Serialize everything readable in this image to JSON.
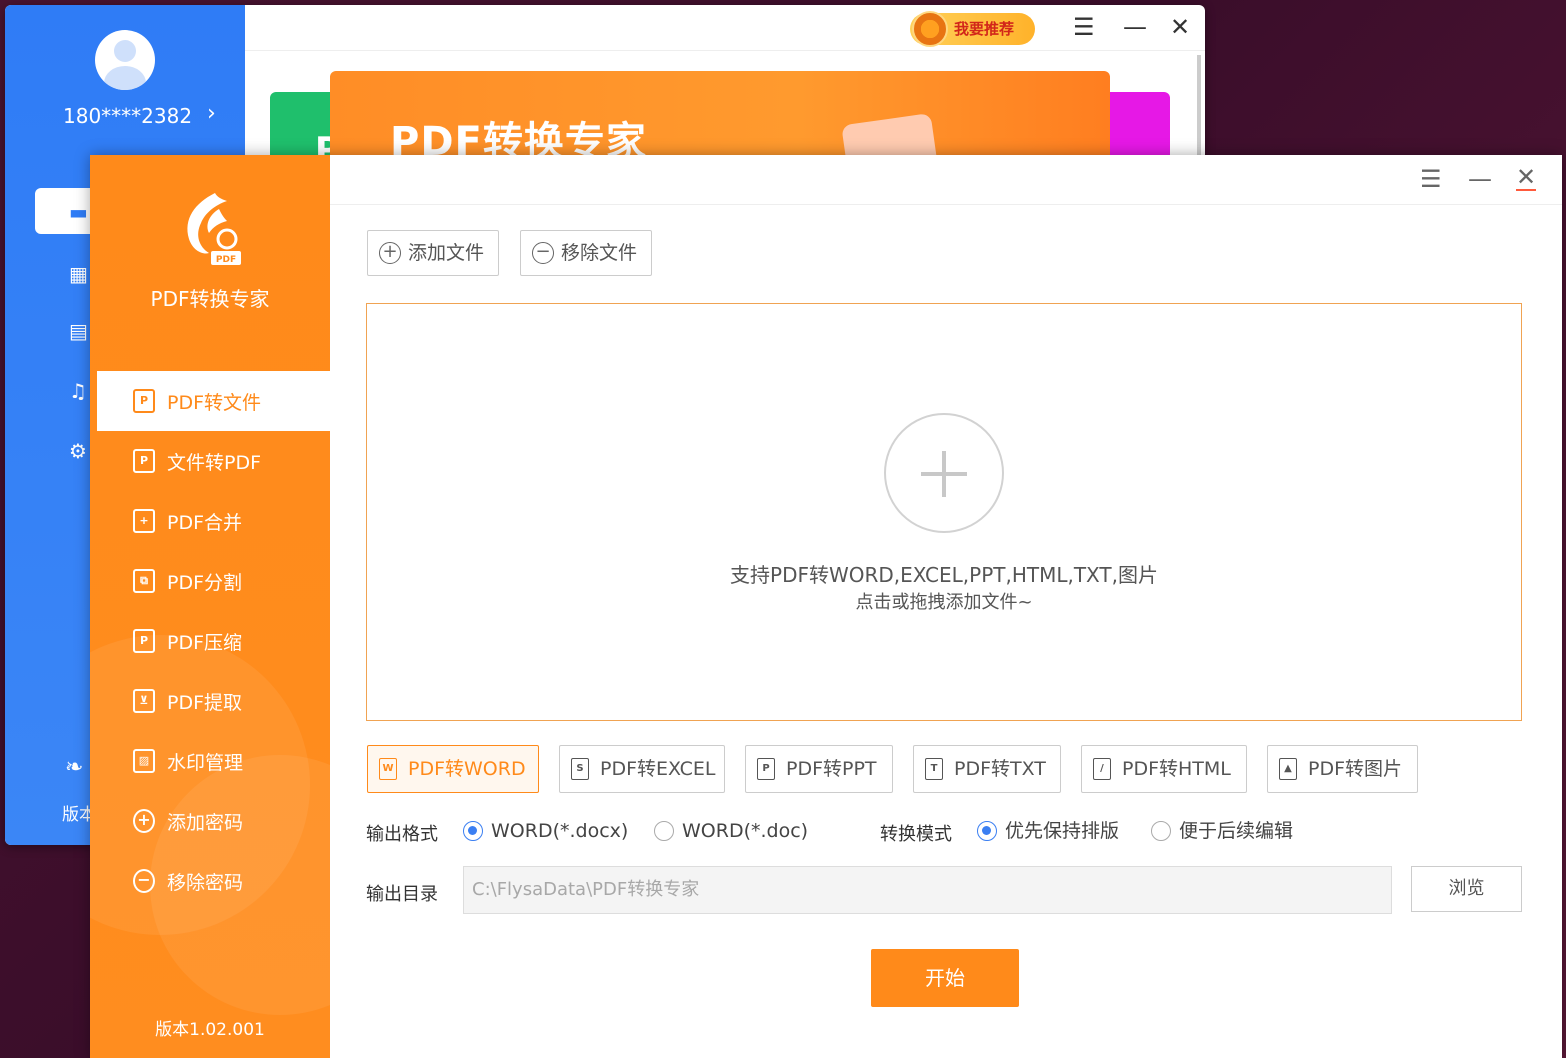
{
  "back_window": {
    "phone": "180****2382",
    "recommend_label": "我要推荐",
    "banner_title": "PDF转换专家",
    "banner_left_text": "P",
    "version_partial": "版本"
  },
  "app": {
    "name": "PDF转换专家",
    "version": "版本1.02.001",
    "accent_color": "#ff8a1a"
  },
  "sidebar": {
    "items": [
      {
        "label": "PDF转文件",
        "icon": "pdf-file-icon",
        "active": true
      },
      {
        "label": "文件转PDF",
        "icon": "file-to-pdf-icon",
        "active": false
      },
      {
        "label": "PDF合并",
        "icon": "merge-icon",
        "active": false
      },
      {
        "label": "PDF分割",
        "icon": "split-icon",
        "active": false
      },
      {
        "label": "PDF压缩",
        "icon": "compress-icon",
        "active": false
      },
      {
        "label": "PDF提取",
        "icon": "extract-icon",
        "active": false
      },
      {
        "label": "水印管理",
        "icon": "watermark-icon",
        "active": false
      },
      {
        "label": "添加密码",
        "icon": "add-password-icon",
        "active": false
      },
      {
        "label": "移除密码",
        "icon": "remove-password-icon",
        "active": false
      }
    ]
  },
  "toolbar": {
    "add_file": "添加文件",
    "remove_file": "移除文件"
  },
  "dropzone": {
    "line1": "支持PDF转WORD,EXCEL,PPT,HTML,TXT,图片",
    "line2": "点击或拖拽添加文件~"
  },
  "mode_tabs": [
    {
      "label": "PDF转WORD",
      "icon": "word-icon",
      "glyph": "W",
      "active": true
    },
    {
      "label": "PDF转EXCEL",
      "icon": "excel-icon",
      "glyph": "S",
      "active": false
    },
    {
      "label": "PDF转PPT",
      "icon": "ppt-icon",
      "glyph": "P",
      "active": false
    },
    {
      "label": "PDF转TXT",
      "icon": "txt-icon",
      "glyph": "T",
      "active": false
    },
    {
      "label": "PDF转HTML",
      "icon": "html-icon",
      "glyph": "/",
      "active": false
    },
    {
      "label": "PDF转图片",
      "icon": "image-icon",
      "glyph": "▲",
      "active": false
    }
  ],
  "output_format": {
    "label": "输出格式",
    "options": [
      {
        "label": "WORD(*.docx)",
        "checked": true
      },
      {
        "label": "WORD(*.doc)",
        "checked": false
      }
    ]
  },
  "convert_mode": {
    "label": "转换模式",
    "options": [
      {
        "label": "优先保持排版",
        "checked": true
      },
      {
        "label": "便于后续编辑",
        "checked": false
      }
    ]
  },
  "output_dir": {
    "label": "输出目录",
    "value": "C:\\FlysaData\\PDF转换专家"
  },
  "browse_label": "浏览",
  "start_label": "开始"
}
